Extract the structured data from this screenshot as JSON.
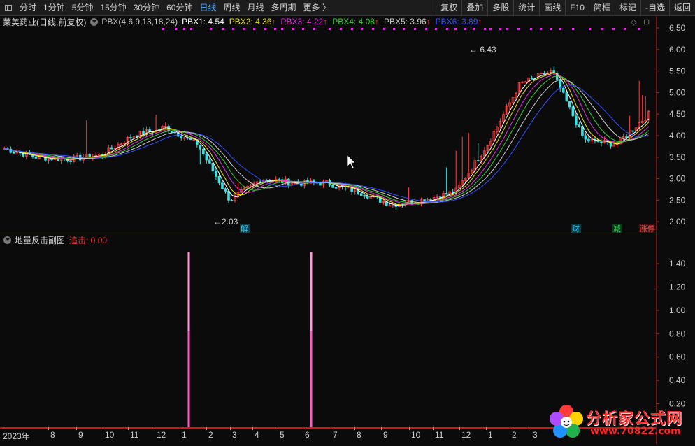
{
  "toolbar": {
    "periods": [
      "分时",
      "1分钟",
      "5分钟",
      "15分钟",
      "30分钟",
      "60分钟",
      "日线",
      "周线",
      "月线",
      "多周期",
      "更多 〉"
    ],
    "active_period": "日线",
    "right_buttons": [
      "复权",
      "叠加",
      "多股",
      "统计",
      "画线",
      "F10",
      "简框",
      "标记",
      "-自选",
      "返回"
    ]
  },
  "info": {
    "stock_name": "莱美药业(日线,前复权)",
    "indicator_params": "PBX(4,6,9,13,18,24)",
    "pbx": [
      {
        "label": "PBX1: 4.54",
        "color": "#ffffff"
      },
      {
        "label": "PBX2: 4.36",
        "color": "#e8e000"
      },
      {
        "label": "PBX3: 4.22",
        "color": "#e030e0"
      },
      {
        "label": "PBX4: 4.08",
        "color": "#30d030"
      },
      {
        "label": "PBX5: 3.96",
        "color": "#d0d0d0"
      },
      {
        "label": "PBX6: 3.89",
        "color": "#3050ff"
      }
    ],
    "arrow": "↑",
    "icons": [
      "◇",
      "⊟"
    ]
  },
  "axis": {
    "main_ticks": [
      "6.50",
      "6.00",
      "5.50",
      "5.00",
      "4.50",
      "4.00",
      "3.50",
      "3.00",
      "2.50",
      "2.00"
    ],
    "sub_ticks": [
      "1.40",
      "1.20",
      "1.00",
      "0.80",
      "0.60",
      "0.40",
      "0.20"
    ]
  },
  "annotations": {
    "high": "← 6.43",
    "low": "←2.03",
    "markers": [
      {
        "text": "解",
        "color": "#3fd0ff"
      },
      {
        "text": "财",
        "color": "#3fd0ff"
      },
      {
        "text": "减",
        "color": "#3fd060"
      },
      {
        "text": "涨停",
        "color": "#ff5050"
      }
    ]
  },
  "sub_panel": {
    "name": "地量反击副图",
    "value_label": "追击: 0.00"
  },
  "x_axis": {
    "labels": [
      "2023年",
      "8",
      "9",
      "10",
      "11",
      "12",
      "1",
      "2",
      "3",
      "4",
      "5",
      "6",
      "7",
      "8",
      "9",
      "10",
      "11",
      "12",
      "1",
      "2",
      "3"
    ]
  },
  "watermark": {
    "text": "分析家公式网",
    "url": "www.70822.com"
  },
  "chart_data": {
    "type": "line",
    "title": "莱美药业(日线,前复权)",
    "ylim": [
      1.9,
      6.65
    ],
    "x": [
      "2023-07",
      "2023-08",
      "2023-09",
      "2023-10",
      "2023-11",
      "2023-12",
      "2024-01",
      "2024-02",
      "2024-03",
      "2024-04",
      "2024-05",
      "2024-06",
      "2024-07",
      "2024-08",
      "2024-09",
      "2024-10",
      "2024-11",
      "2024-12",
      "2025-01",
      "2025-02",
      "2025-03"
    ],
    "series": [
      {
        "name": "PBX1",
        "values": [
          3.7,
          3.5,
          3.45,
          3.55,
          4.0,
          4.2,
          3.8,
          2.5,
          3.0,
          2.9,
          2.9,
          2.7,
          2.4,
          2.5,
          2.7,
          3.8,
          5.2,
          5.5,
          3.9,
          3.8,
          4.5
        ]
      },
      {
        "name": "PBX6",
        "values": [
          3.75,
          3.6,
          3.5,
          3.5,
          3.9,
          4.05,
          3.9,
          2.9,
          3.05,
          3.0,
          2.95,
          2.8,
          2.5,
          2.5,
          2.6,
          3.4,
          4.3,
          4.9,
          4.2,
          3.9,
          3.9
        ]
      }
    ],
    "high": 6.43,
    "low": 2.03,
    "sub_series": {
      "name": "追击",
      "spikes": [
        1.5,
        1.5
      ],
      "ylim": [
        0,
        1.55
      ]
    }
  }
}
